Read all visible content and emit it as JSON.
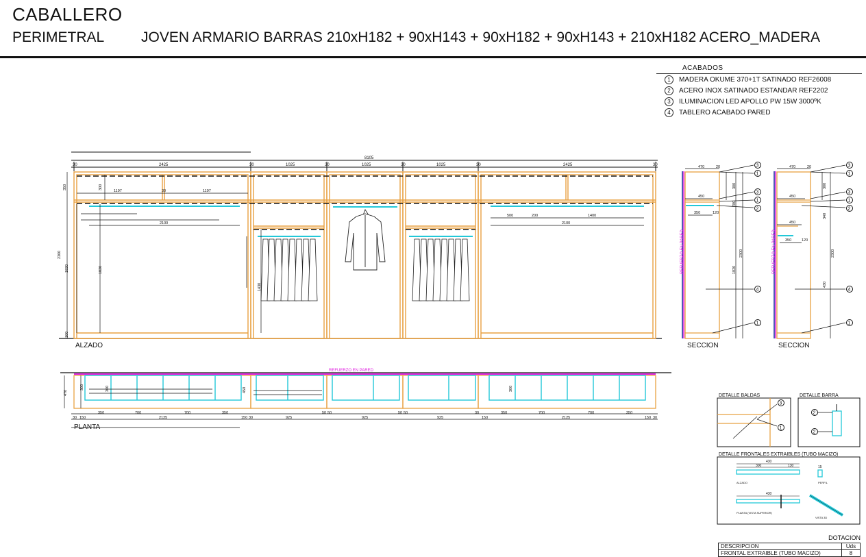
{
  "header": {
    "title": "CABALLERO",
    "subtitle": "PERIMETRAL",
    "description": "JOVEN ARMARIO BARRAS 210xH182 + 90xH143 + 90xH182 + 90xH143 + 210xH182 ACERO_MADERA"
  },
  "acabados": {
    "title": "ACABADOS",
    "items": [
      {
        "num": "1",
        "text": "MADERA OKUME 370+1T SATINADO REF26008"
      },
      {
        "num": "2",
        "text": "ACERO INOX SATINADO ESTANDAR REF2202"
      },
      {
        "num": "3",
        "text": "ILUMINACION LED APOLLO PW 15W 3000ºK"
      },
      {
        "num": "4",
        "text": "TABLERO ACABADO PARED"
      }
    ]
  },
  "alzado": {
    "label": "ALZADO",
    "total": "8105",
    "top_dims": [
      "30",
      "2425",
      "30",
      "1025",
      "30",
      "1025",
      "30",
      "1025",
      "30",
      "2425",
      "30"
    ],
    "dims": {
      "d1197a": "1197",
      "d30": "30",
      "d1197b": "1197",
      "d2100a": "2100",
      "d2100b": "2100",
      "d500": "500",
      "d200": "200",
      "d1400": "1400",
      "d350": "350",
      "d300": "300",
      "d2300": "2300",
      "d1820": "1820",
      "d1820b": "1820",
      "d1430": "1430",
      "d100": "100"
    }
  },
  "seccion": {
    "label": "SECCION",
    "refuerzo": "REFUERZO EN PARED",
    "dims": {
      "d470": "470",
      "d20": "20",
      "d450": "450",
      "d350": "350",
      "d120": "120",
      "d300": "300",
      "d2300": "2300",
      "d1820": "1820",
      "d780": "780",
      "d340": "340",
      "d430": "430",
      "d1400": "1400"
    },
    "callouts": [
      "3",
      "1",
      "3",
      "1",
      "2",
      "4",
      "1"
    ]
  },
  "planta": {
    "label": "PLANTA",
    "refuerzo": "REFUERZO EN PARED",
    "bottom_dims": [
      "30",
      "150",
      "350",
      "700",
      "2125",
      "700",
      "350",
      "150",
      "30",
      "925",
      "50",
      "50",
      "925",
      "50",
      "50",
      "925",
      "30",
      "150",
      "350",
      "700",
      "2125",
      "700",
      "350",
      "150",
      "30"
    ],
    "side_dims": [
      "470",
      "300",
      "450",
      "300",
      "300"
    ]
  },
  "detalles": {
    "baldas": "DETALLE BALDAS",
    "barra": "DETALLE BARRA",
    "frontales": "DETALLE FRONTALES EXTRAIBLES (TUBO MACIZO)",
    "alzado_lbl": "ALZADO",
    "perfil_lbl": "PERFIL",
    "planta_lbl": "PLANTA (VISTA SUPERIOR)",
    "vista_lbl": "VISTA 3D",
    "d430": "430",
    "d300": "300",
    "d130": "130",
    "d15": "15",
    "d430b": "430"
  },
  "dotacion": {
    "title": "DOTACION",
    "headers": [
      "DESCRIPCION",
      "Uds"
    ],
    "rows": [
      [
        "FRONTAL EXTRAIBLE (TUBO MACIZO)",
        "8"
      ]
    ]
  },
  "colors": {
    "wood": "#e8a040",
    "steel": "#22c8d8",
    "refuerzo": "#e020e0",
    "line": "#111111"
  }
}
